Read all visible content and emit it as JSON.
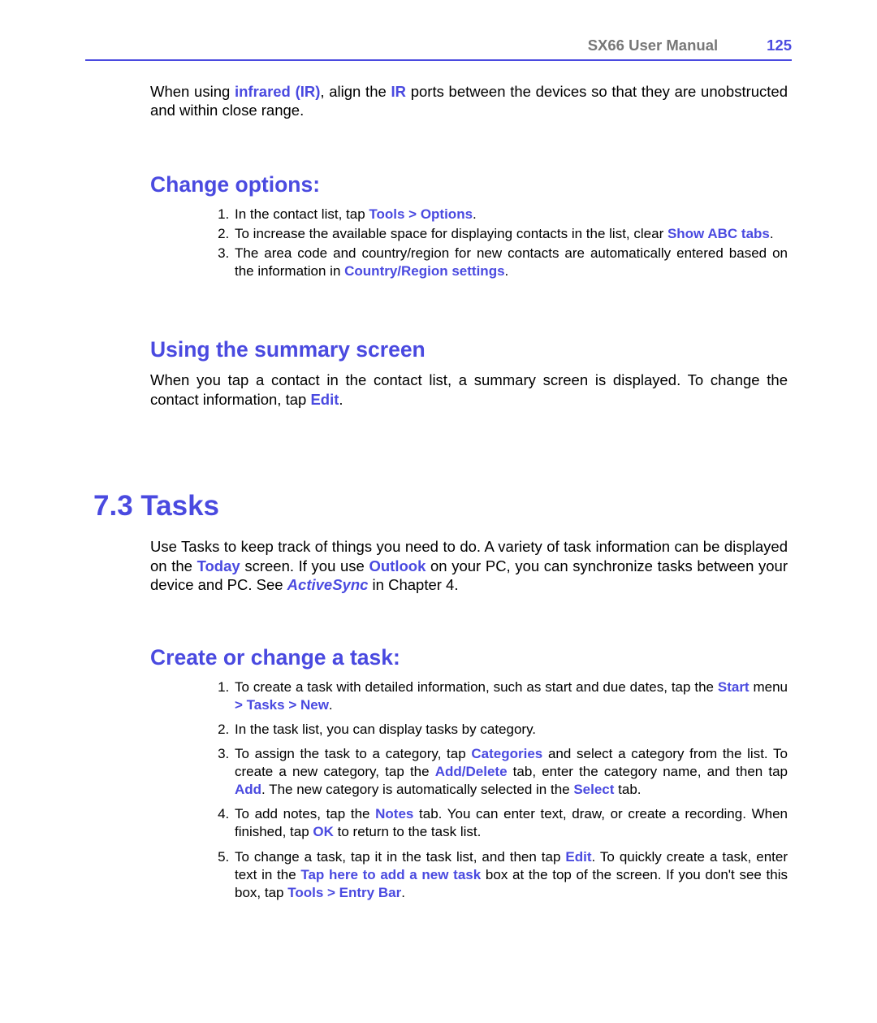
{
  "header": {
    "title": "SX66 User Manual",
    "page": "125"
  },
  "intro": {
    "t1": "When using ",
    "kw1": "infrared (IR)",
    "t2": ", align the ",
    "kw2": "IR",
    "t3": " ports between the devices so that they are unob­structed and within close range."
  },
  "changeOptions": {
    "heading": "Change options:",
    "li1a": "In the contact list, tap ",
    "li1kw": "Tools > Options",
    "li1b": ".",
    "li2a": "To increase the available space for displaying contacts in the list, clear ",
    "li2kw": "Show ABC tabs",
    "li2b": ".",
    "li3a": "The area code and country/region for new contacts are automatically entered based on the information in ",
    "li3kw": "Country/Region settings",
    "li3b": "."
  },
  "summary": {
    "heading": "Using the summary screen",
    "t1": "When you tap a contact in the contact list, a summary screen is displayed. To change the contact information, tap ",
    "kw1": "Edit",
    "t2": "."
  },
  "section": {
    "heading": "7.3  Tasks",
    "t1": "Use Tasks to keep track of things you need to do. A variety of task information can be displayed on the ",
    "kw1": "Today",
    "t2": " screen. If you use ",
    "kw2": "Outlook",
    "t3": " on your PC, you can synchronize tasks between your device and PC. See ",
    "kw3": "ActiveSync",
    "t4": " in Chapter 4."
  },
  "createTask": {
    "heading": "Create or change a task:",
    "li1a": "To create a task with detailed information, such as start and due dates, tap the ",
    "li1kw1": "Start",
    "li1b": " menu ",
    "li1kw2": "> Tasks > New",
    "li1c": ".",
    "li2": "In the task list, you can display tasks by category.",
    "li3a": "To assign the task to a category, tap ",
    "li3kw1": "Categories",
    "li3b": " and select a category from the list. To create a new category, tap the ",
    "li3kw2": "Add/Delete",
    "li3c": " tab, enter the category name, and then tap ",
    "li3kw3": "Add",
    "li3d": ". The new category is automatically selected in the ",
    "li3kw4": "Select",
    "li3e": " tab.",
    "li4a": "To add notes, tap the ",
    "li4kw1": "Notes",
    "li4b": " tab. You can enter text, draw, or create a recording. When finished, tap ",
    "li4kw2": "OK",
    "li4c": " to return to the task list.",
    "li5a": "To change a task, tap it in the task list, and then tap ",
    "li5kw1": "Edit",
    "li5b": ". To quickly create a task, enter text in the ",
    "li5kw2": "Tap here to add a new task",
    "li5c": " box at the top of the screen. If you don't see this box, tap ",
    "li5kw3": "Tools > Entry Bar",
    "li5d": "."
  }
}
